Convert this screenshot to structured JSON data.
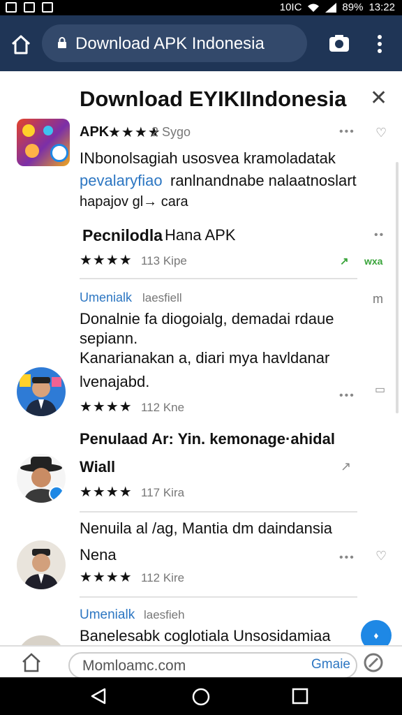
{
  "status_bar": {
    "signal_text": "10IC",
    "battery": "89%",
    "time": "13:22"
  },
  "browser": {
    "url_text": "Download APK Indonesia"
  },
  "panel": {
    "title": "Download  EYIKIIndonesia",
    "app": {
      "name": "APK",
      "stars": "★★★★",
      "rating_text": "2 Sygo",
      "desc_line1": "INbonolsagiah usosvea kramoladatak",
      "desc_line2_link": "pevalaryfiao",
      "desc_line2_rest": "ranlnandnabe nalaatnoslart",
      "desc_line3": "hapajov gl→ cara"
    },
    "section": {
      "title": "Pecnilodla",
      "title_small": "Hana APK",
      "stars": "★★★★",
      "count": "113 Kipe",
      "right_badge": "wxa"
    },
    "review1": {
      "author": "Umenialk",
      "author_sub": "laesfiell",
      "line1": "Donalnie fa diogoialg, demadai rdaue",
      "line2": "sepiann.",
      "line3": "Kanarianakan a,  diari mya havldanar",
      "line4": "lvenajabd.",
      "stars": "★★★★",
      "count": "112 Kne",
      "side_label": "m"
    },
    "review2": {
      "line1": "Penulaad Ar: Yin. kemonage·ahidal",
      "line2": "Wiall",
      "stars": "★★★★",
      "count": "117 Kira"
    },
    "review3": {
      "line1": "Nenuila al /ag, Mantia dm daindansia",
      "line2": "Nena",
      "stars": "★★★★",
      "count": "112 Kire"
    },
    "review4": {
      "author": "Umenialk",
      "author_sub": "laesfieh",
      "line1": "Banelesabk coglotiala Unsosidamiaa"
    }
  },
  "bottom_bar": {
    "input_text": "Momloamc.com",
    "chip": "Gmaie"
  }
}
